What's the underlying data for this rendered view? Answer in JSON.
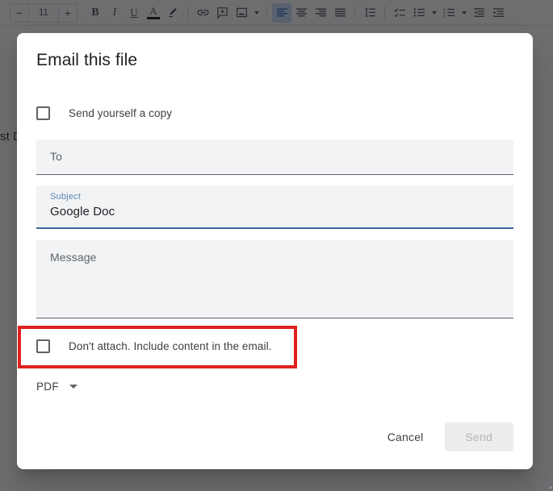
{
  "toolbar": {
    "font_size_decrease": "−",
    "font_size_value": "11",
    "font_size_increase": "+",
    "bold": "B",
    "italic": "I",
    "underline": "U",
    "text_color": "A",
    "items": [
      {
        "name": "decrease-font-size-button",
        "label": "−"
      },
      {
        "name": "font-size-input",
        "label": "11"
      },
      {
        "name": "increase-font-size-button",
        "label": "+"
      },
      {
        "name": "bold-button",
        "label": "B"
      },
      {
        "name": "italic-button",
        "label": "I"
      },
      {
        "name": "underline-button",
        "label": "U"
      },
      {
        "name": "text-color-button",
        "label": "A"
      },
      {
        "name": "highlight-color-button",
        "label": "highlighter-icon"
      },
      {
        "name": "insert-link-button",
        "label": "link-icon"
      },
      {
        "name": "add-comment-button",
        "label": "comment-plus-icon"
      },
      {
        "name": "insert-image-button",
        "label": "image-icon"
      },
      {
        "name": "align-left-button",
        "label": "align-left-icon"
      },
      {
        "name": "align-center-button",
        "label": "align-center-icon"
      },
      {
        "name": "align-right-button",
        "label": "align-right-icon"
      },
      {
        "name": "align-justify-button",
        "label": "align-justify-icon"
      },
      {
        "name": "line-spacing-button",
        "label": "line-spacing-icon"
      },
      {
        "name": "checklist-button",
        "label": "checklist-icon"
      },
      {
        "name": "bulleted-list-button",
        "label": "bulleted-list-icon"
      },
      {
        "name": "numbered-list-button",
        "label": "numbered-list-icon"
      },
      {
        "name": "decrease-indent-button",
        "label": "decrease-indent-icon"
      },
      {
        "name": "increase-indent-button",
        "label": "increase-indent-icon"
      }
    ]
  },
  "document": {
    "clipped_text": "st D"
  },
  "dialog": {
    "title": "Email this file",
    "send_copy_checkbox": {
      "label": "Send yourself a copy",
      "checked": false
    },
    "to_field": {
      "placeholder": "To",
      "value": ""
    },
    "subject_field": {
      "label": "Subject",
      "value": "Google Doc"
    },
    "message_field": {
      "placeholder": "Message",
      "value": ""
    },
    "attach_checkbox": {
      "label": "Don't attach. Include content in the email.",
      "checked": false
    },
    "format_dropdown": {
      "value": "PDF"
    },
    "cancel_label": "Cancel",
    "send_label": "Send"
  },
  "colors": {
    "highlight_red": "#e02020",
    "focus_blue": "#3b6694",
    "label_blue": "#5e87b5",
    "field_fill": "#f1f3f4",
    "overlay": "#202124"
  }
}
